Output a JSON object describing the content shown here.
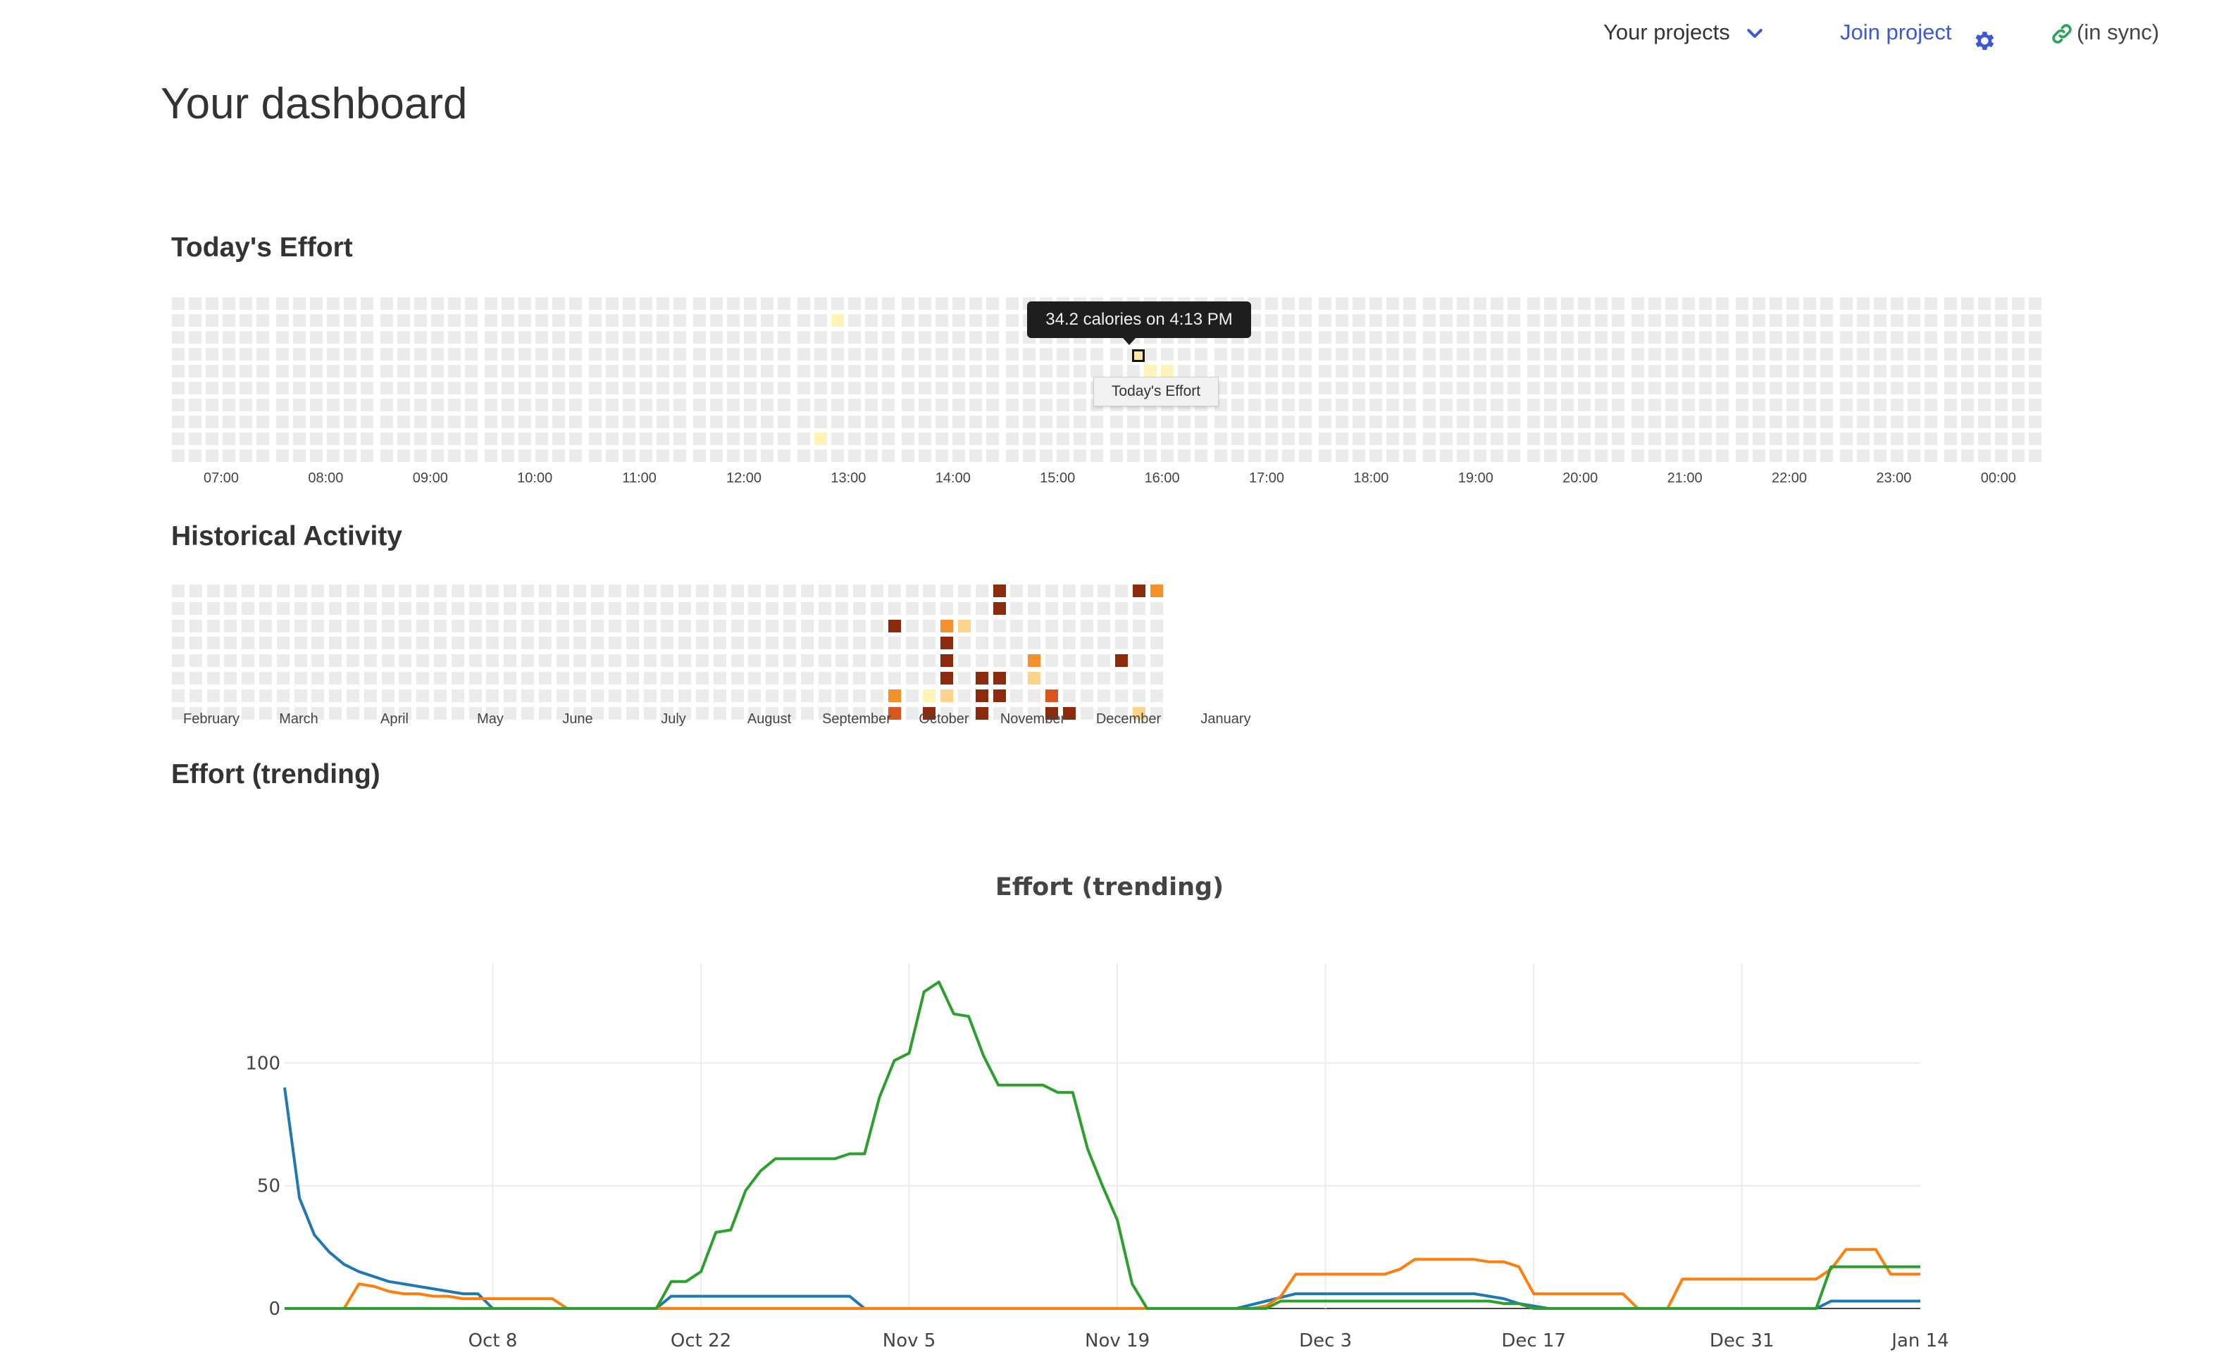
{
  "nav": {
    "projects_label": "Your projects",
    "join_label": "Join project",
    "settings_icon": "gear-icon",
    "sync_label": "(in sync)",
    "sync_icon": "link-icon",
    "accent": "#3d57d8",
    "sync_color": "#2ca25f"
  },
  "page": {
    "title": "Your dashboard"
  },
  "sections": {
    "today": "Today's Effort",
    "history": "Historical Activity",
    "trend": "Effort (trending)"
  },
  "today": {
    "hour_labels": [
      "07:00",
      "08:00",
      "09:00",
      "10:00",
      "11:00",
      "12:00",
      "13:00",
      "14:00",
      "15:00",
      "16:00",
      "17:00",
      "18:00",
      "19:00",
      "20:00",
      "21:00",
      "22:00",
      "23:00",
      "00:00"
    ],
    "tooltip": "34.2 calories on 4:13 PM",
    "hover_label": "Today's Effort",
    "highlighted": [
      {
        "col": 38,
        "row": 1,
        "level": 1
      },
      {
        "col": 37,
        "row": 8,
        "level": 1
      },
      {
        "col": 56,
        "row": 4,
        "level": 1
      },
      {
        "col": 57,
        "row": 4,
        "level": 1
      }
    ]
  },
  "history": {
    "month_labels": [
      "February",
      "March",
      "April",
      "May",
      "June",
      "July",
      "August",
      "September",
      "October",
      "November",
      "December",
      "January"
    ],
    "palette": [
      "#ebebeb",
      "#fff4b8",
      "#fdd28a",
      "#f5902f",
      "#d9561e",
      "#8b2a0d"
    ],
    "active": [
      {
        "col": 41,
        "row": 2,
        "level": 5
      },
      {
        "col": 41,
        "row": 6,
        "level": 3
      },
      {
        "col": 41,
        "row": 7,
        "level": 4
      },
      {
        "col": 44,
        "row": 2,
        "level": 3
      },
      {
        "col": 44,
        "row": 3,
        "level": 5
      },
      {
        "col": 44,
        "row": 4,
        "level": 5
      },
      {
        "col": 44,
        "row": 5,
        "level": 5
      },
      {
        "col": 44,
        "row": 6,
        "level": 2
      },
      {
        "col": 43,
        "row": 6,
        "level": 1
      },
      {
        "col": 43,
        "row": 7,
        "level": 5
      },
      {
        "col": 45,
        "row": 2,
        "level": 2
      },
      {
        "col": 47,
        "row": 0,
        "level": 5
      },
      {
        "col": 47,
        "row": 1,
        "level": 5
      },
      {
        "col": 47,
        "row": 5,
        "level": 5
      },
      {
        "col": 47,
        "row": 6,
        "level": 5
      },
      {
        "col": 46,
        "row": 5,
        "level": 5
      },
      {
        "col": 46,
        "row": 6,
        "level": 5
      },
      {
        "col": 46,
        "row": 7,
        "level": 5
      },
      {
        "col": 49,
        "row": 4,
        "level": 3
      },
      {
        "col": 49,
        "row": 5,
        "level": 2
      },
      {
        "col": 50,
        "row": 6,
        "level": 4
      },
      {
        "col": 50,
        "row": 7,
        "level": 5
      },
      {
        "col": 51,
        "row": 7,
        "level": 5
      },
      {
        "col": 54,
        "row": 4,
        "level": 5
      },
      {
        "col": 55,
        "row": 0,
        "level": 5
      },
      {
        "col": 56,
        "row": 0,
        "level": 3
      },
      {
        "col": 55,
        "row": 7,
        "level": 2
      }
    ]
  },
  "chart_data": {
    "type": "line",
    "title": "Effort (trending)",
    "x_ticks": [
      "Oct 8",
      "Oct 22",
      "Nov 5",
      "Nov 19",
      "Dec 3",
      "Dec 17",
      "Dec 31",
      "Jan 14"
    ],
    "x_start": "Sep 25",
    "x_end": "Jan 14",
    "y_ticks": [
      0,
      50,
      100
    ],
    "ylim": [
      0,
      140
    ],
    "grid": true,
    "series": [
      {
        "color": "#1f77b4",
        "points": [
          [
            0,
            90
          ],
          [
            1,
            45
          ],
          [
            2,
            30
          ],
          [
            3,
            23
          ],
          [
            4,
            18
          ],
          [
            5,
            15
          ],
          [
            6,
            13
          ],
          [
            7,
            11
          ],
          [
            8,
            10
          ],
          [
            9,
            9
          ],
          [
            10,
            8
          ],
          [
            11,
            7
          ],
          [
            12,
            6
          ],
          [
            13,
            6
          ],
          [
            14,
            0
          ],
          [
            25,
            0
          ],
          [
            26,
            5
          ],
          [
            37,
            5
          ],
          [
            38,
            5
          ],
          [
            39,
            0
          ],
          [
            64,
            0
          ],
          [
            66,
            3
          ],
          [
            68,
            6
          ],
          [
            70,
            6
          ],
          [
            80,
            6
          ],
          [
            82,
            4
          ],
          [
            83,
            2
          ],
          [
            85,
            0
          ],
          [
            103,
            0
          ],
          [
            104,
            3
          ],
          [
            105,
            3
          ],
          [
            110,
            3
          ]
        ]
      },
      {
        "color": "#ff7f0e",
        "points": [
          [
            0,
            0
          ],
          [
            4,
            0
          ],
          [
            5,
            10
          ],
          [
            6,
            9
          ],
          [
            7,
            7
          ],
          [
            8,
            6
          ],
          [
            9,
            6
          ],
          [
            10,
            5
          ],
          [
            11,
            5
          ],
          [
            12,
            4
          ],
          [
            13,
            4
          ],
          [
            18,
            4
          ],
          [
            19,
            0
          ],
          [
            65,
            0
          ],
          [
            66,
            1
          ],
          [
            67,
            5
          ],
          [
            68,
            14
          ],
          [
            74,
            14
          ],
          [
            75,
            16
          ],
          [
            76,
            20
          ],
          [
            80,
            20
          ],
          [
            81,
            19
          ],
          [
            82,
            19
          ],
          [
            83,
            17
          ],
          [
            84,
            6
          ],
          [
            90,
            6
          ],
          [
            91,
            0
          ],
          [
            93,
            0
          ],
          [
            94,
            12
          ],
          [
            103,
            12
          ],
          [
            104,
            16
          ],
          [
            105,
            24
          ],
          [
            106,
            24
          ],
          [
            107,
            24
          ],
          [
            108,
            14
          ],
          [
            110,
            14
          ]
        ]
      },
      {
        "color": "#2ca02c",
        "points": [
          [
            0,
            0
          ],
          [
            25,
            0
          ],
          [
            26,
            11
          ],
          [
            27,
            11
          ],
          [
            28,
            15
          ],
          [
            29,
            31
          ],
          [
            30,
            32
          ],
          [
            31,
            48
          ],
          [
            32,
            56
          ],
          [
            33,
            61
          ],
          [
            37,
            61
          ],
          [
            38,
            63
          ],
          [
            39,
            63
          ],
          [
            40,
            86
          ],
          [
            41,
            101
          ],
          [
            42,
            104
          ],
          [
            43,
            129
          ],
          [
            44,
            133
          ],
          [
            45,
            120
          ],
          [
            46,
            119
          ],
          [
            47,
            103
          ],
          [
            48,
            91
          ],
          [
            51,
            91
          ],
          [
            52,
            88
          ],
          [
            53,
            88
          ],
          [
            54,
            65
          ],
          [
            55,
            50
          ],
          [
            56,
            36
          ],
          [
            57,
            10
          ],
          [
            58,
            0
          ],
          [
            66,
            0
          ],
          [
            67,
            3
          ],
          [
            80,
            3
          ],
          [
            81,
            3
          ],
          [
            82,
            2
          ],
          [
            83,
            2
          ],
          [
            84,
            0
          ],
          [
            101,
            0
          ],
          [
            102,
            0
          ],
          [
            103,
            0
          ],
          [
            104,
            17
          ],
          [
            110,
            17
          ]
        ]
      }
    ]
  }
}
